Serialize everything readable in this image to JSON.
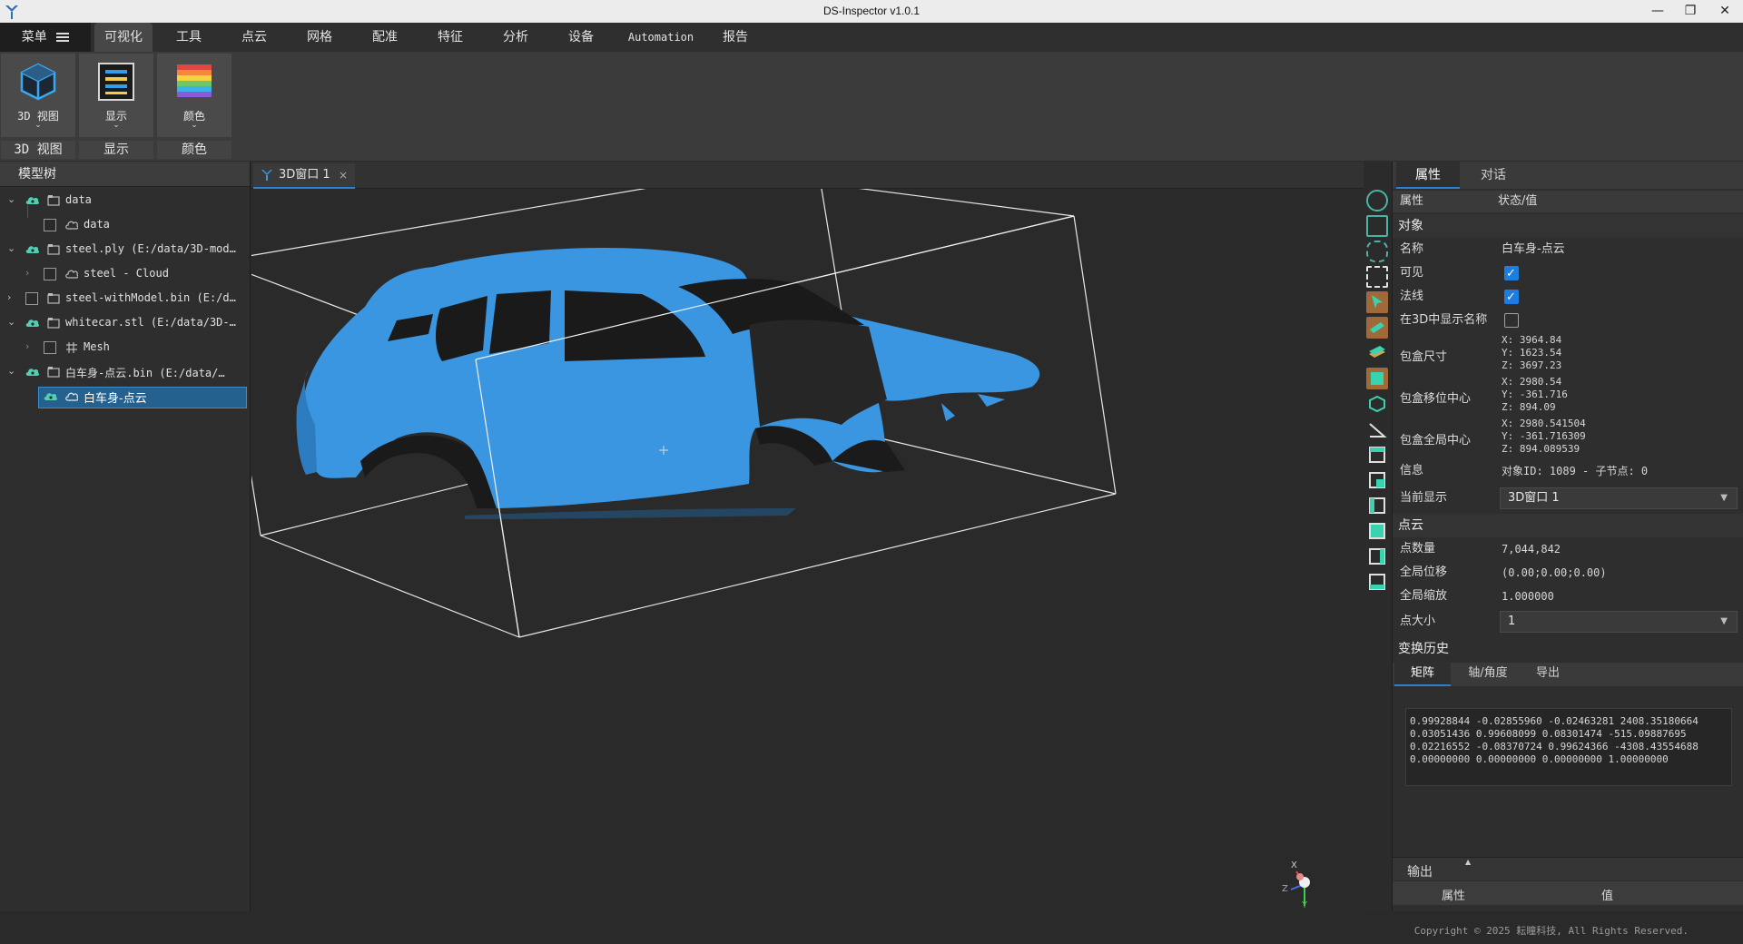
{
  "window": {
    "title": "DS-Inspector v1.0.1",
    "minimize": "—",
    "restore": "❐",
    "close": "✕"
  },
  "menu": {
    "main_label": "菜单",
    "items": [
      "可视化",
      "工具",
      "点云",
      "网格",
      "配准",
      "特征",
      "分析",
      "设备",
      "Automation",
      "报告"
    ],
    "active": "可视化"
  },
  "ribbon": {
    "groups": [
      {
        "button": "3D 视图",
        "group_label": "3D 视图",
        "icon": "cube-icon"
      },
      {
        "button": "显示",
        "group_label": "显示",
        "icon": "display-icon"
      },
      {
        "button": "颜色",
        "group_label": "颜色",
        "icon": "palette-icon"
      }
    ],
    "caret": "⌄"
  },
  "model_tree": {
    "header": "模型树",
    "rows": [
      {
        "label": "data",
        "level": 0,
        "expanded": true,
        "visible": true
      },
      {
        "label": "data",
        "level": 1,
        "expanded": false,
        "visible": false
      },
      {
        "label": "steel.ply (E:/data/3D-mod…",
        "level": 0,
        "expanded": true,
        "visible": true
      },
      {
        "label": "steel - Cloud",
        "level": 1,
        "expanded": false,
        "visible": false
      },
      {
        "label": "steel-withModel.bin (E:/d…",
        "level": 0,
        "expanded": false,
        "visible": false
      },
      {
        "label": "whitecar.stl (E:/data/3D-…",
        "level": 0,
        "expanded": true,
        "visible": true
      },
      {
        "label": "Mesh",
        "level": 1,
        "expanded": false,
        "visible": false
      },
      {
        "label": "白车身-点云.bin (E:/data/…",
        "level": 0,
        "expanded": true,
        "visible": true
      },
      {
        "label": "白车身-点云",
        "level": 1,
        "expanded": false,
        "visible": true,
        "selected": true
      }
    ]
  },
  "viewport": {
    "tab_label": "3D窗口 1",
    "tab_close": "×",
    "accent": "#3a96e0"
  },
  "properties": {
    "tabs": [
      "属性",
      "对话"
    ],
    "col_prop": "属性",
    "col_value": "状态/值",
    "object_section": "对象",
    "name_key": "名称",
    "name_val": "白车身-点云",
    "visible_key": "可见",
    "visible": true,
    "normals_key": "法线",
    "normals": true,
    "show_name_key": "在3D中显示名称",
    "show_name": false,
    "bbox_dim_key": "包盒尺寸",
    "bbox_dim": [
      "X: 3964.84",
      "Y: 1623.54",
      "Z: 3697.23"
    ],
    "bbox_shift_key": "包盒移位中心",
    "bbox_shift": [
      "X: 2980.54",
      "Y: -361.716",
      "Z: 894.09"
    ],
    "bbox_global_key": "包盒全局中心",
    "bbox_global": [
      "X: 2980.541504",
      "Y: -361.716309",
      "Z: 894.089539"
    ],
    "info_key": "信息",
    "info_val": "对象ID: 1089 - 子节点: 0",
    "current_display_key": "当前显示",
    "current_display": "3D窗口 1",
    "cloud_section": "点云",
    "points_key": "点数量",
    "points": "7,044,842",
    "global_shift_key": "全局位移",
    "global_shift": "(0.00;0.00;0.00)",
    "global_scale_key": "全局缩放",
    "global_scale": "1.000000",
    "point_size_key": "点大小",
    "point_size": "1",
    "transform_section": "变换历史",
    "transform_tabs": [
      "矩阵",
      "轴/角度",
      "导出"
    ],
    "matrix": [
      "0.99928844 -0.02855960 -0.02463281 2408.35180664",
      "0.03051436 0.99608099 0.08301474 -515.09887695",
      "0.02216552 -0.08370724 0.99624366 -4308.43554688",
      "0.00000000 0.00000000 0.00000000 1.00000000"
    ]
  },
  "output": {
    "title": "输出",
    "col_prop": "属性",
    "col_value": "值"
  },
  "axis_gizmo": {
    "x": "X",
    "y": "Y",
    "z": "Z"
  },
  "footer": {
    "copyright": "Copyright © 2025 耘瞳科技, All Rights Reserved."
  }
}
